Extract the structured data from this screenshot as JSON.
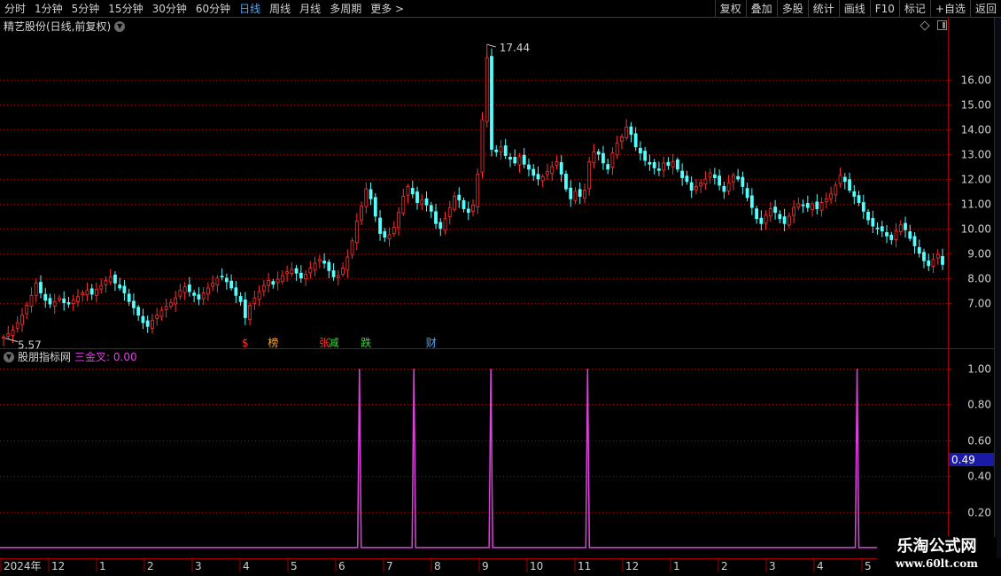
{
  "toolbar": {
    "periods": [
      "分时",
      "1分钟",
      "5分钟",
      "15分钟",
      "30分钟",
      "60分钟",
      "日线",
      "周线",
      "月线",
      "多周期",
      "更多 >"
    ],
    "active_period": "日线",
    "tools": [
      "复权",
      "叠加",
      "多股",
      "统计",
      "画线",
      "F10",
      "标记",
      "+自选",
      "返回"
    ]
  },
  "main_title": "精艺股份(日线,前复权)",
  "sub_panel": {
    "indicator_name": "股朋指标网",
    "series_label": "三金叉: 0.00"
  },
  "colors": {
    "up": "#ff3232",
    "down": "#54ffff",
    "indicator": "#e040e0",
    "grid": "#8a1010",
    "axis": "#a00000"
  },
  "watermark": {
    "title": "乐淘公式网",
    "url": "www.60lt.com"
  },
  "chart_data": [
    {
      "type": "candlestick",
      "y_ticks": [
        "7.00",
        "8.00",
        "9.00",
        "10.00",
        "11.00",
        "12.00",
        "13.00",
        "14.00",
        "15.00",
        "16.00"
      ],
      "ylim": [
        5.2,
        17.8
      ],
      "high_label": "17.44",
      "low_label": "5.57",
      "high_value": 17.44,
      "low_value": 5.57,
      "events": [
        {
          "label": "$",
          "color": "#ff3030",
          "index": 52
        },
        {
          "label": "榜",
          "color": "#ffaa33",
          "index": 58
        },
        {
          "label": "张",
          "color": "#ff3030",
          "index": 69
        },
        {
          "label": "减",
          "color": "#33dd33",
          "index": 71
        },
        {
          "label": "跌",
          "color": "#33dd33",
          "index": 78
        },
        {
          "label": "财",
          "color": "#4aa8ff",
          "index": 92
        }
      ],
      "close": [
        5.62,
        5.75,
        5.9,
        6.2,
        6.5,
        6.9,
        7.3,
        7.8,
        7.4,
        7.1,
        6.95,
        7.05,
        7.2,
        7.0,
        6.95,
        7.1,
        7.25,
        7.4,
        7.5,
        7.35,
        7.55,
        7.7,
        7.9,
        8.05,
        7.8,
        7.6,
        7.4,
        7.05,
        6.8,
        6.5,
        6.2,
        6.05,
        6.3,
        6.5,
        6.7,
        6.85,
        7.0,
        7.2,
        7.5,
        7.65,
        7.45,
        7.3,
        7.15,
        7.4,
        7.6,
        7.8,
        8.0,
        8.05,
        7.85,
        7.6,
        7.3,
        7.05,
        6.4,
        6.9,
        7.2,
        7.45,
        7.7,
        7.9,
        7.75,
        7.95,
        8.1,
        8.25,
        8.35,
        8.2,
        8.0,
        8.15,
        8.4,
        8.6,
        8.75,
        8.6,
        8.3,
        8.05,
        8.1,
        8.4,
        8.85,
        9.5,
        10.3,
        10.9,
        11.6,
        11.2,
        10.5,
        9.8,
        9.65,
        9.75,
        10.05,
        10.65,
        11.3,
        11.7,
        11.4,
        11.05,
        11.15,
        10.95,
        10.7,
        10.2,
        10.0,
        10.4,
        10.85,
        11.3,
        11.15,
        10.8,
        10.65,
        10.95,
        12.2,
        14.4,
        16.9,
        13.2,
        13.1,
        13.3,
        12.95,
        12.8,
        12.65,
        12.9,
        12.6,
        12.4,
        12.15,
        12.0,
        12.1,
        12.3,
        12.5,
        12.7,
        12.2,
        11.6,
        11.2,
        11.5,
        11.3,
        11.55,
        12.7,
        13.1,
        13.0,
        12.65,
        12.4,
        13.05,
        13.45,
        13.7,
        14.1,
        13.8,
        13.3,
        13.05,
        12.75,
        12.6,
        12.45,
        12.35,
        12.65,
        12.55,
        12.7,
        12.4,
        12.05,
        11.9,
        11.55,
        11.7,
        11.85,
        12.0,
        12.25,
        12.05,
        11.75,
        11.5,
        11.85,
        12.15,
        12.0,
        11.7,
        11.25,
        10.85,
        10.4,
        10.2,
        10.55,
        10.8,
        10.65,
        10.4,
        10.2,
        10.5,
        10.85,
        11.0,
        10.95,
        10.85,
        11.0,
        10.8,
        11.05,
        11.2,
        11.4,
        11.75,
        12.15,
        11.9,
        11.55,
        11.3,
        11.05,
        10.7,
        10.35,
        10.1,
        10.0,
        9.9,
        9.7,
        9.55,
        9.9,
        10.15,
        9.95,
        9.6,
        9.3,
        9.0,
        8.7,
        8.5,
        8.75,
        8.95,
        8.55
      ]
    },
    {
      "type": "line",
      "series": [
        {
          "name": "三金叉",
          "x": [
            0.379,
            0.437,
            0.519,
            0.622,
            0.909
          ],
          "values": [
            1.0,
            1.0,
            1.0,
            1.0,
            1.0
          ]
        }
      ],
      "y_ticks": [
        "0.20",
        "0.40",
        "0.60",
        "0.80",
        "1.00"
      ],
      "ylim": [
        -0.05,
        1.08
      ],
      "current_value_label": "0.49",
      "current_value": 0.49
    }
  ],
  "x_axis_labels": [
    "2024年",
    "12",
    "1",
    "2",
    "3",
    "4",
    "5",
    "6",
    "7",
    "8",
    "9",
    "10",
    "11",
    "12",
    "1",
    "2",
    "3",
    "4",
    "5"
  ]
}
